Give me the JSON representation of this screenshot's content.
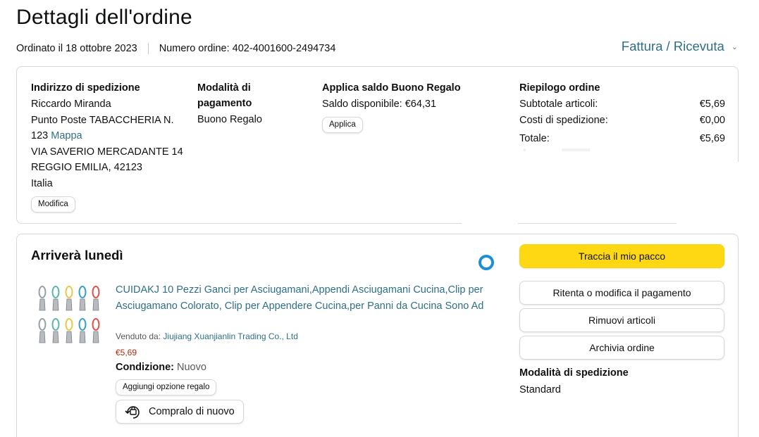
{
  "page": {
    "title": "Dettagli dell'ordine",
    "ordered_on": "Ordinato il 18 ottobre 2023",
    "order_number": "Numero ordine: 402-4001600-2494734",
    "invoice_link": "Fattura / Ricevuta"
  },
  "shipping_address": {
    "heading": "Indirizzo di spedizione",
    "name": "Riccardo Miranda",
    "line1": "Punto Poste TABACCHERIA N.",
    "line2": "123",
    "map_link": "Mappa",
    "street": "VIA SAVERIO MERCADANTE 14",
    "city": "REGGIO EMILIA, 42123",
    "country": "Italia",
    "edit_button": "Modifica"
  },
  "payment": {
    "heading_line1": "Modalità di",
    "heading_line2": "pagamento",
    "method": "Buono Regalo"
  },
  "gift_balance": {
    "heading": "Applica saldo Buono Regalo",
    "available": "Saldo disponibile: €64,31",
    "apply_button": "Applica"
  },
  "summary": {
    "heading": "Riepilogo ordine",
    "rows": [
      {
        "label": "Subtotale articoli:",
        "value": "€5,69"
      },
      {
        "label": "Costi di spedizione:",
        "value": "€0,00"
      }
    ],
    "total_label": "Totale:",
    "total_value": "€5,69"
  },
  "shipment": {
    "arrival": "Arriverà lunedì",
    "product_title": "CUIDAKJ 10 Pezzi Ganci per Asciugamani,Appendi Asciugamani Cucina,Clip per Asciugamano Colorato, Clip per Appendere Cucina,per Panni da Cucina Sono Ad",
    "seller_label": "Venduto da:",
    "seller_name": "Jiujiang Xuanjianlin Trading Co., Ltd",
    "price": "€5,69",
    "condition_label": "Condizione:",
    "condition_value": "Nuovo",
    "gift_option_button": "Aggiungi opzione regalo",
    "buy_again_button": "Compralo di nuovo",
    "hook_colors": [
      "#9aa0a6",
      "#5bb8a8",
      "#e9c84a",
      "#3a9fc9",
      "#d9534f"
    ]
  },
  "actions": {
    "track_button": "Traccia il mio pacco",
    "retry_button": "Ritenta o modifica il pagamento",
    "remove_button": "Rimuovi articoli",
    "archive_button": "Archivia ordine",
    "shipping_mode_heading": "Modalità di spedizione",
    "shipping_mode_value": "Standard"
  },
  "colors": {
    "link": "#2f6f86",
    "primary_button": "#ffd814",
    "price": "#b12704",
    "loader": "#1a8fd6"
  }
}
